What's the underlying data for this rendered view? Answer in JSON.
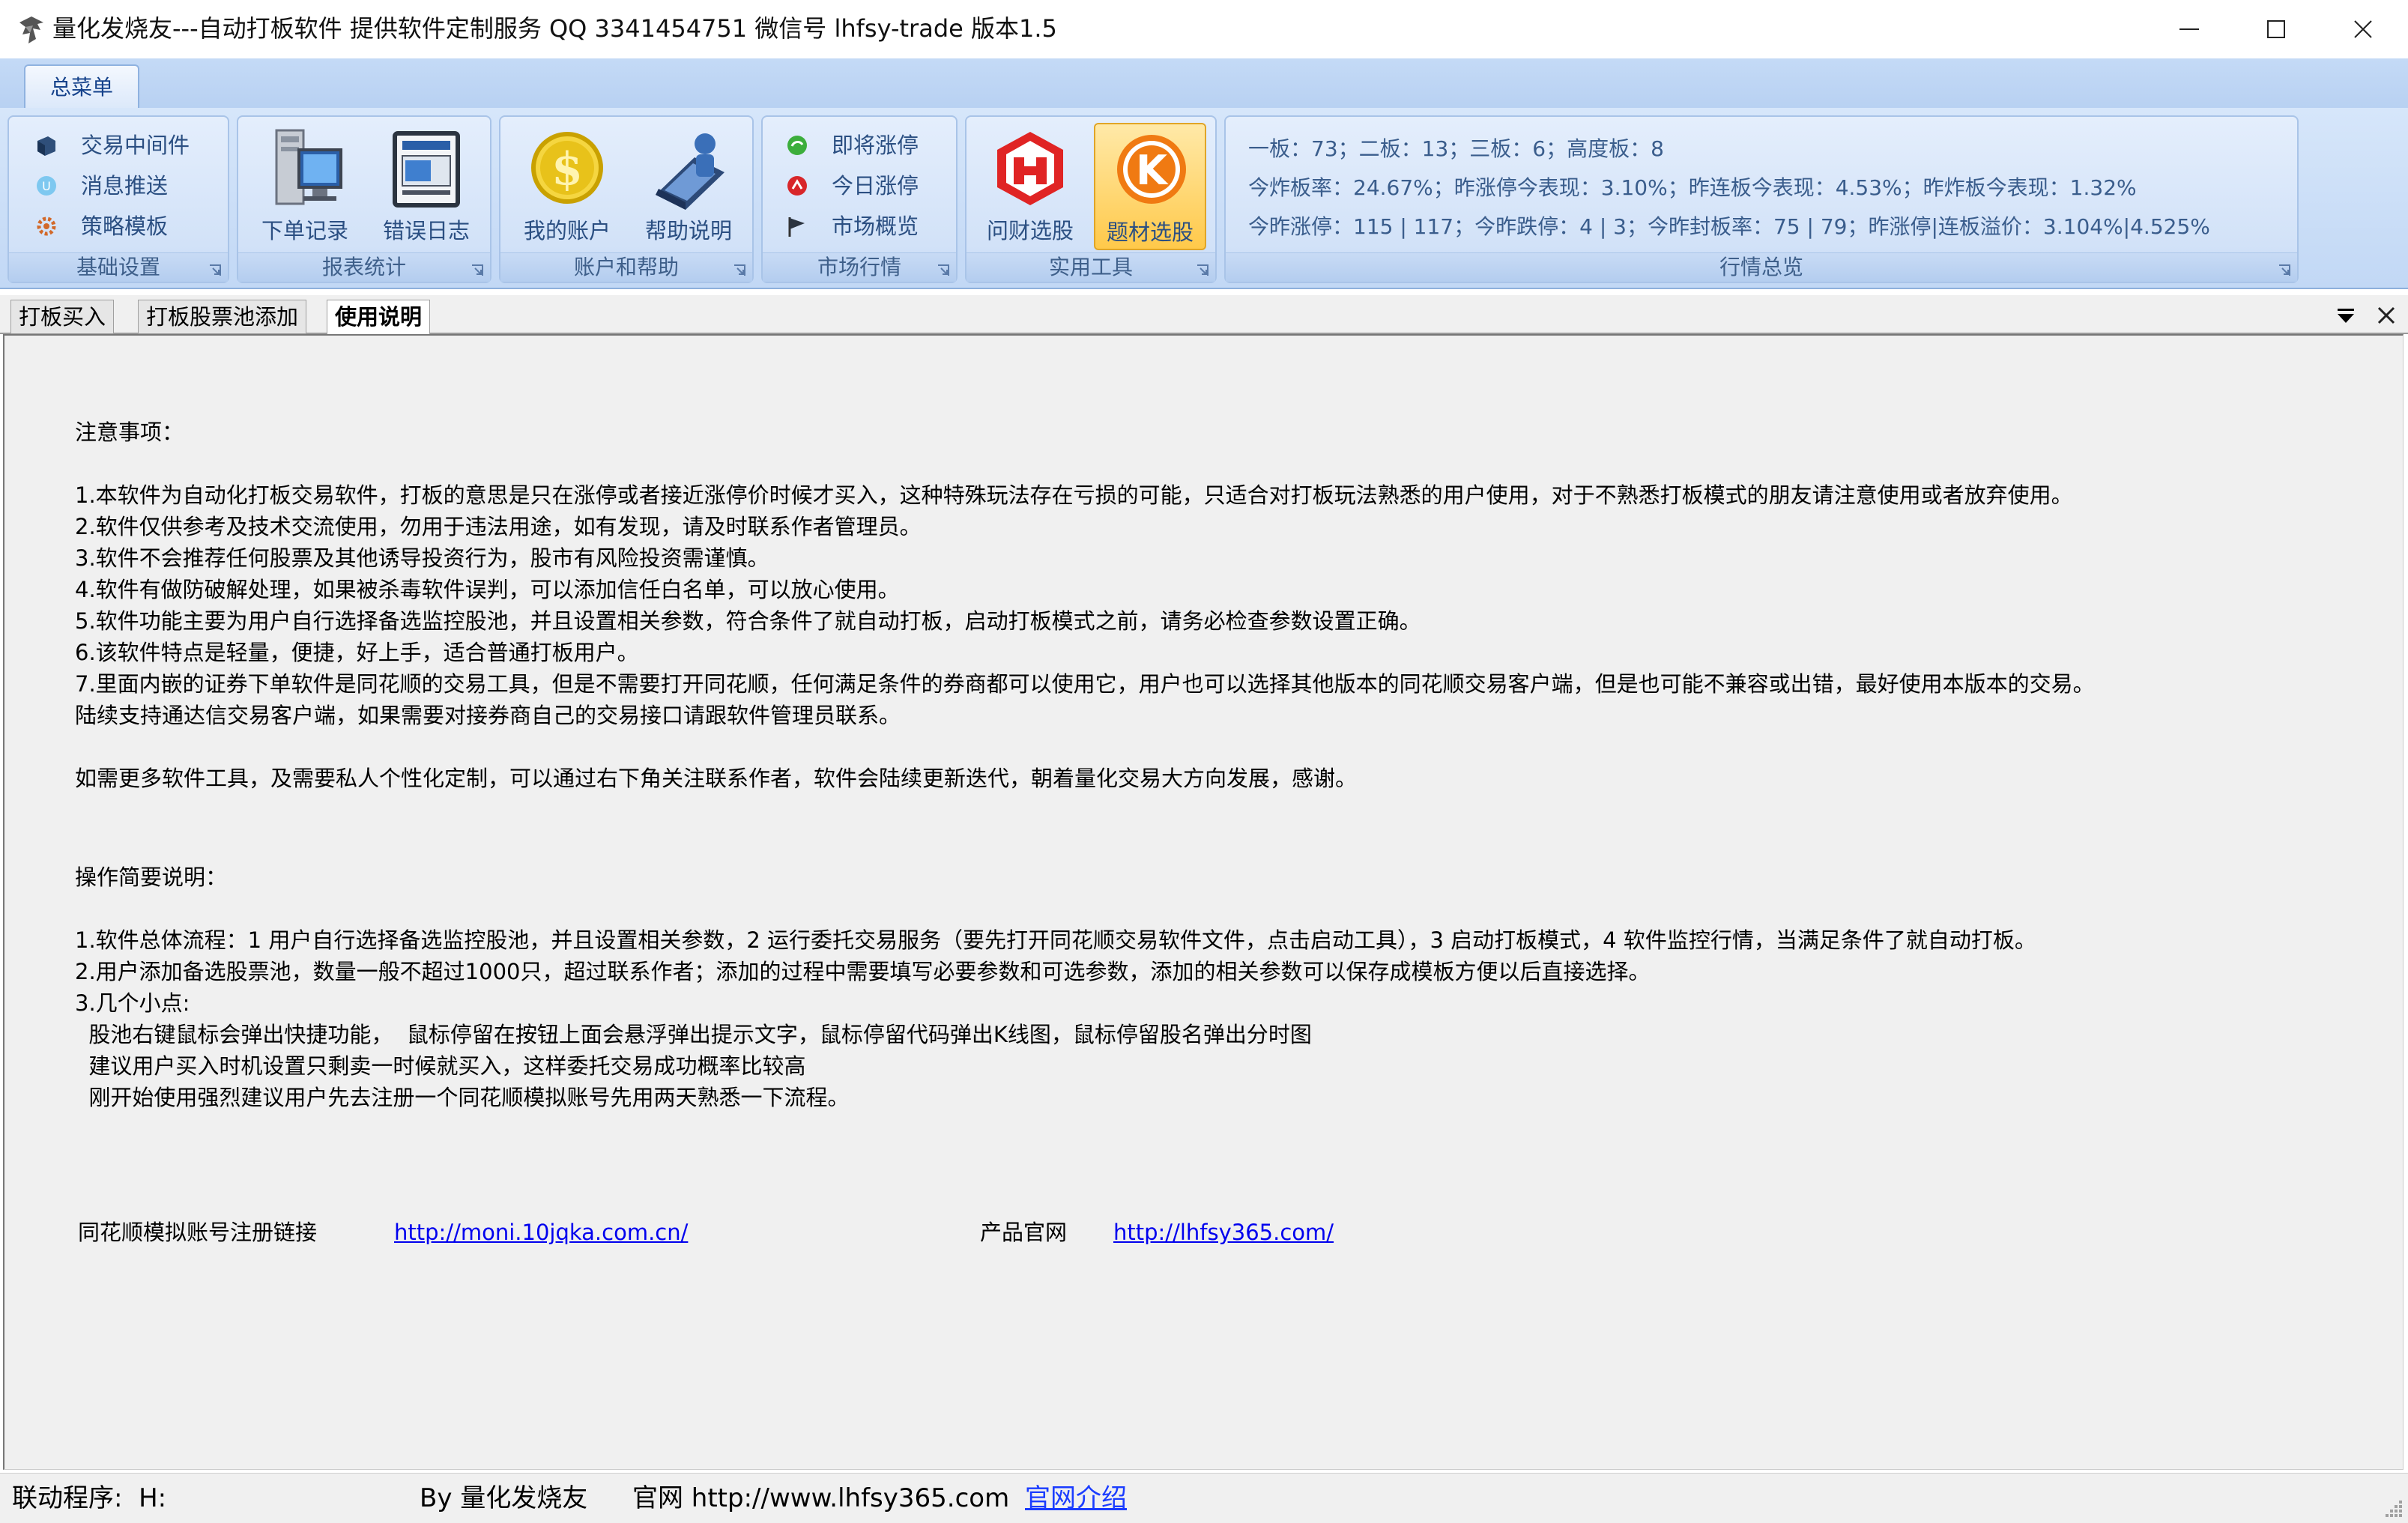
{
  "window": {
    "title": "量化发烧友---自动打板软件 提供软件定制服务 QQ 3341454751 微信号 lhfsy-trade  版本1.5"
  },
  "ribbon": {
    "tab_label": "总菜单",
    "groups": {
      "basic": {
        "label": "基础设置",
        "items": [
          "交易中间件",
          "消息推送",
          "策略模板"
        ]
      },
      "report": {
        "label": "报表统计",
        "buttons": [
          "下单记录",
          "错误日志"
        ]
      },
      "account": {
        "label": "账户和帮助",
        "buttons": [
          "我的账户",
          "帮助说明"
        ]
      },
      "market": {
        "label": "市场行情",
        "items": [
          "即将涨停",
          "今日涨停",
          "市场概览"
        ]
      },
      "tools": {
        "label": "实用工具",
        "buttons": [
          "问财选股",
          "题材选股"
        ]
      },
      "overview": {
        "label": "行情总览",
        "lines": [
          "一板：73；二板：13；三板：6；高度板：8",
          "今炸板率：24.67%；昨涨停今表现：3.10%；昨连板今表现：4.53%；昨炸板今表现：1.32%",
          "今昨涨停：115 | 117；今昨跌停：4 | 3；今昨封板率：75 | 79；昨涨停|连板溢价：3.104%|4.525%"
        ]
      }
    }
  },
  "doc_tabs": [
    "打板买入",
    "打板股票池添加",
    "使用说明"
  ],
  "content": {
    "notice_heading": "注意事项：",
    "notice_lines": [
      "1.本软件为自动化打板交易软件，打板的意思是只在涨停或者接近涨停价时候才买入，这种特殊玩法存在亏损的可能，只适合对打板玩法熟悉的用户使用，对于不熟悉打板模式的朋友请注意使用或者放弃使用。",
      "2.软件仅供参考及技术交流使用，勿用于违法用途，如有发现，请及时联系作者管理员。",
      "3.软件不会推荐任何股票及其他诱导投资行为，股市有风险投资需谨慎。",
      "4.软件有做防破解处理，如果被杀毒软件误判，可以添加信任白名单，可以放心使用。",
      "5.软件功能主要为用户自行选择备选监控股池，并且设置相关参数，符合条件了就自动打板，启动打板模式之前，请务必检查参数设置正确。",
      "6.该软件特点是轻量，便捷，好上手，适合普通打板用户。",
      "7.里面内嵌的证券下单软件是同花顺的交易工具，但是不需要打开同花顺，任何满足条件的券商都可以使用它，用户也可以选择其他版本的同花顺交易客户端，但是也可能不兼容或出错，最好使用本版本的交易。",
      "陆续支持通达信交易客户端，如果需要对接券商自己的交易接口请跟软件管理员联系。"
    ],
    "more_line": "如需更多软件工具，及需要私人个性化定制，可以通过右下角关注联系作者，软件会陆续更新迭代，朝着量化交易大方向发展，感谢。",
    "ops_heading": "操作简要说明：",
    "ops_lines": [
      "1.软件总体流程：1 用户自行选择备选监控股池，并且设置相关参数，2 运行委托交易服务（要先打开同花顺交易软件文件，点击启动工具），3 启动打板模式，4 软件监控行情，当满足条件了就自动打板。",
      "2.用户添加备选股票池，数量一般不超过1000只，超过联系作者；添加的过程中需要填写必要参数和可选参数，添加的相关参数可以保存成模板方便以后直接选择。",
      "3.几个小点:",
      "  股池右键鼠标会弹出快捷功能，  鼠标停留在按钮上面会悬浮弹出提示文字，鼠标停留代码弹出K线图，鼠标停留股名弹出分时图",
      "  建议用户买入时机设置只剩卖一时候就买入，这样委托交易成功概率比较高",
      "  刚开始使用强烈建议用户先去注册一个同花顺模拟账号先用两天熟悉一下流程。"
    ],
    "links": {
      "register_label": "同花顺模拟账号注册链接",
      "register_url": "http://moni.10jqka.com.cn/",
      "site_label": "产品官网",
      "site_url": "http://lhfsy365.com/"
    }
  },
  "statusbar": {
    "linked_program": "联动程序:  H:",
    "author": "By 量化发烧友",
    "website": "官网 http://www.lhfsy365.com",
    "intro_link": "官网介绍"
  },
  "colors": {
    "ribbon_bg": "#c2d8f5",
    "ribbon_text": "#2b4f82",
    "active_button": "#ffc94a",
    "link": "#0000ee"
  }
}
